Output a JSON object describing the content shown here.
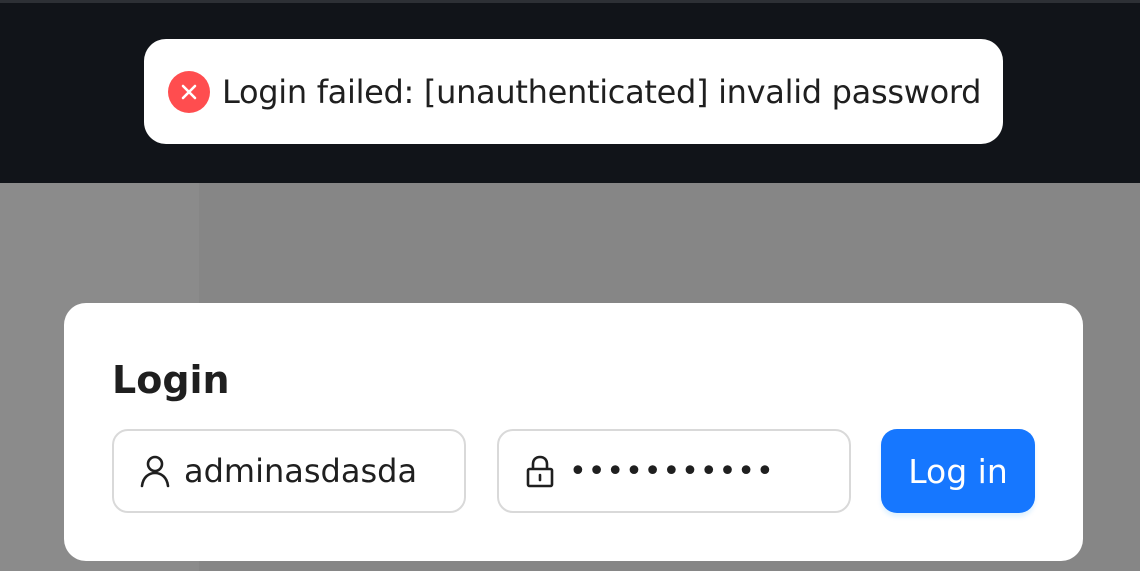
{
  "toast": {
    "icon": "error-close-icon",
    "message": "Login failed: [unauthenticated] invalid password"
  },
  "login_card": {
    "title": "Login",
    "username": {
      "icon": "user-icon",
      "value": "adminasdasda"
    },
    "password": {
      "icon": "lock-icon",
      "masked_value": "•••••••••••"
    },
    "submit_label": "Log in"
  },
  "colors": {
    "header_background": "#111419",
    "overlay_background": "#888888",
    "error": "#ff4d4f",
    "primary": "#1677ff"
  }
}
